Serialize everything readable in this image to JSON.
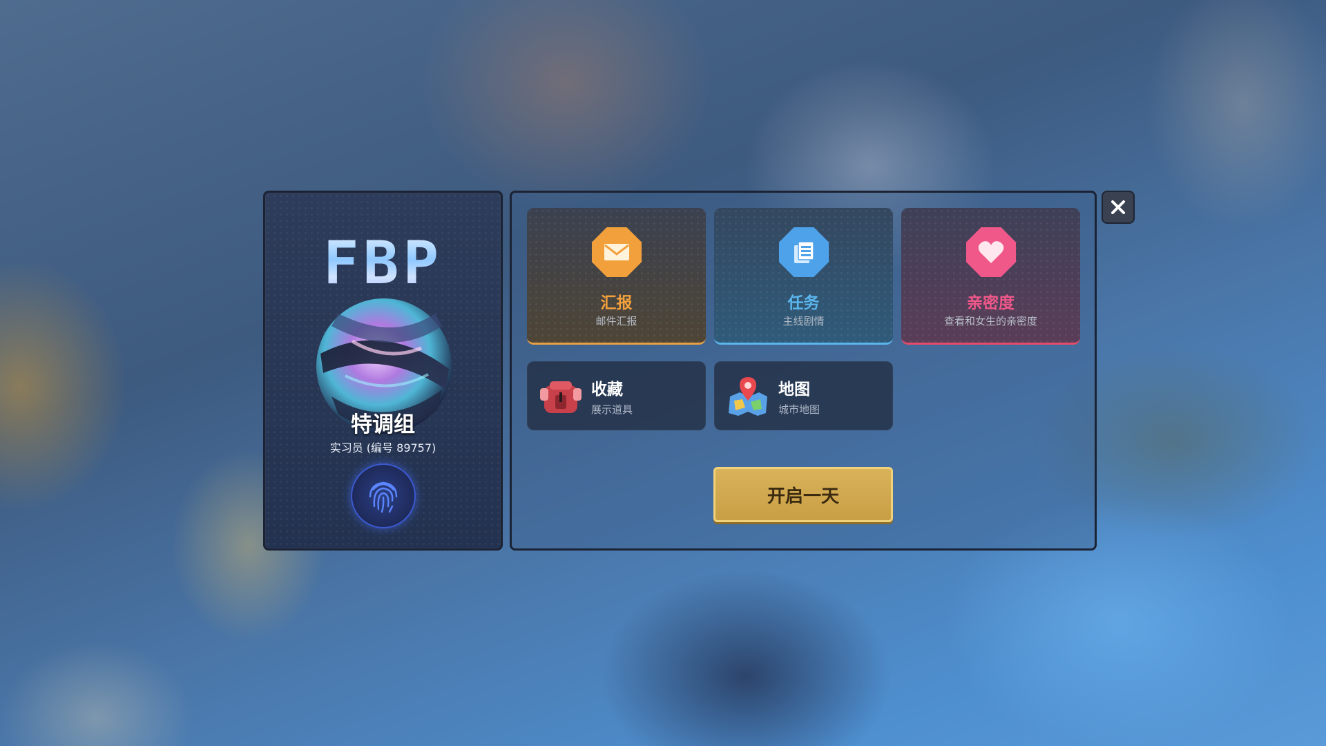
{
  "profile": {
    "logo": "FBP",
    "group_name": "特调组",
    "rank": "实习员 (编号 89757)",
    "orb_icon": "orb-emblem-icon",
    "fingerprint_icon": "fingerprint-icon"
  },
  "menu": {
    "report": {
      "title": "汇报",
      "subtitle": "邮件汇报",
      "icon": "envelope-icon",
      "color": "#f2a03c"
    },
    "task": {
      "title": "任务",
      "subtitle": "主线剧情",
      "icon": "document-icon",
      "color": "#5bb6ee"
    },
    "intimacy": {
      "title": "亲密度",
      "subtitle": "查看和女生的亲密度",
      "icon": "heart-icon",
      "color": "#f0588a"
    },
    "collection": {
      "title": "收藏",
      "subtitle": "展示道具",
      "icon": "backpack-icon"
    },
    "map": {
      "title": "地图",
      "subtitle": "城市地图",
      "icon": "map-pin-icon"
    }
  },
  "start_button": {
    "label": "开启一天",
    "color": "#d9b25a"
  },
  "close_icon": "close-icon"
}
